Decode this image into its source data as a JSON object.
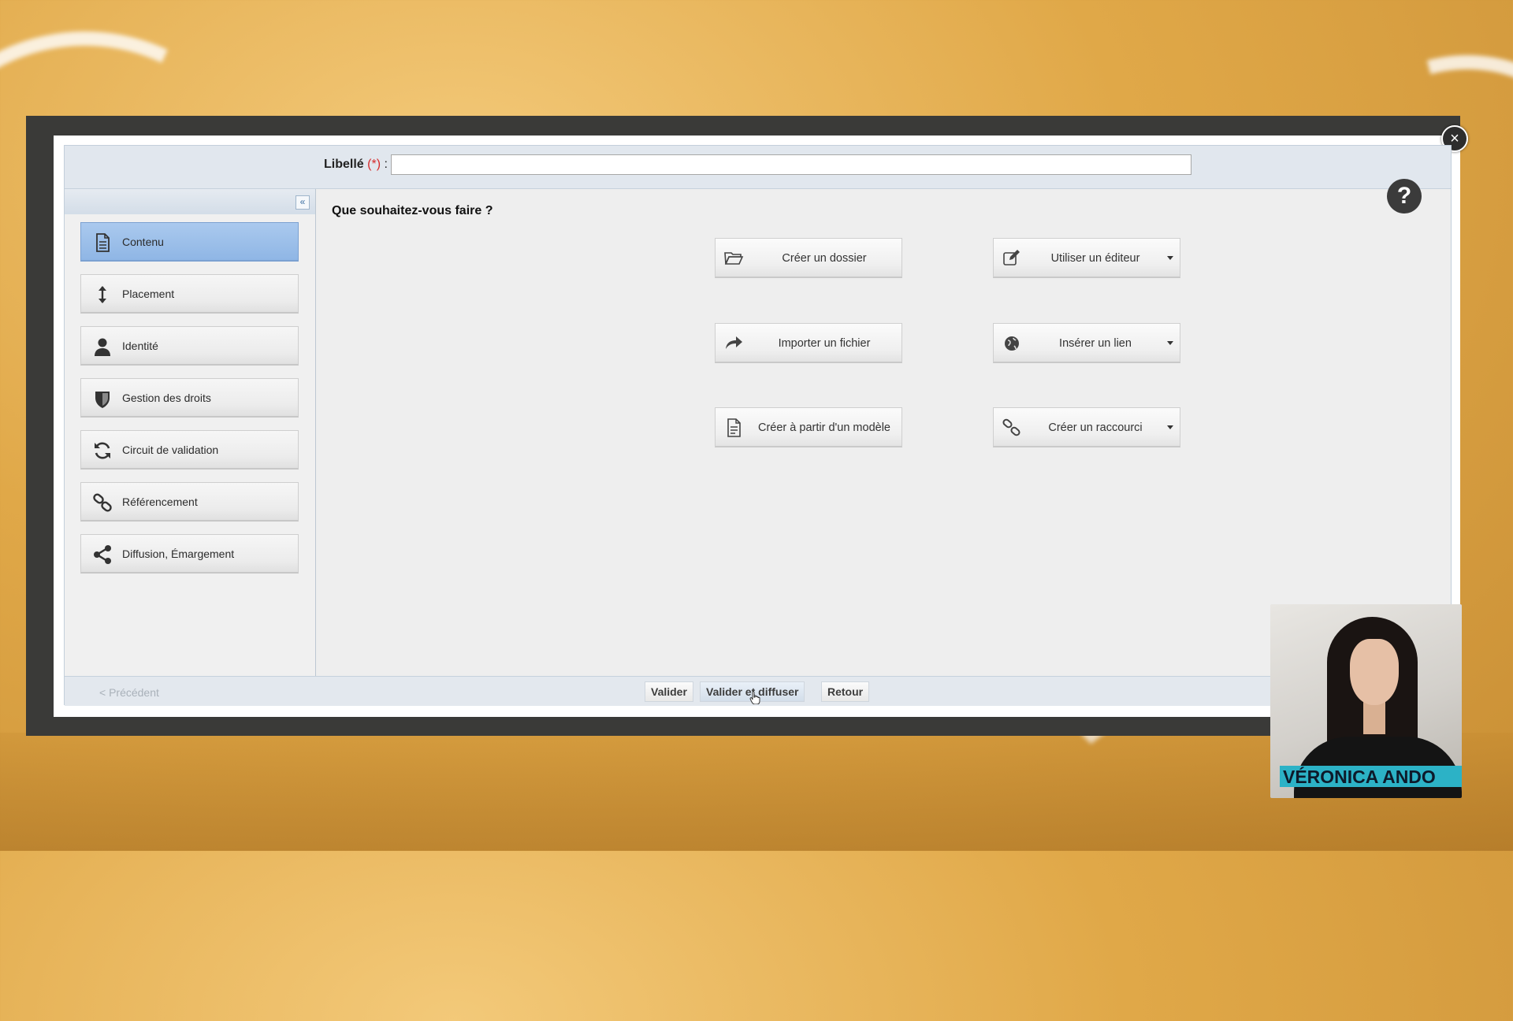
{
  "form": {
    "libelle_label": "Libellé",
    "required_marker": "(*)",
    "colon": ":",
    "libelle_value": ""
  },
  "dialog": {
    "close_symbol": "×",
    "help_symbol": "?",
    "collapse_symbol": "«"
  },
  "sidebar": {
    "items": [
      {
        "label": "Contenu",
        "icon": "document-icon",
        "active": true
      },
      {
        "label": "Placement",
        "icon": "vertical-arrows-icon",
        "active": false
      },
      {
        "label": "Identité",
        "icon": "user-icon",
        "active": false
      },
      {
        "label": "Gestion des droits",
        "icon": "shield-icon",
        "active": false
      },
      {
        "label": "Circuit de validation",
        "icon": "refresh-icon",
        "active": false
      },
      {
        "label": "Référencement",
        "icon": "link-icon",
        "active": false
      },
      {
        "label": "Diffusion, Émargement",
        "icon": "share-icon",
        "active": false
      }
    ]
  },
  "main": {
    "question": "Que souhaitez-vous faire ?",
    "actions": [
      {
        "label": "Créer un dossier",
        "icon": "folder-open-icon",
        "dropdown": false
      },
      {
        "label": "Utiliser un éditeur",
        "icon": "edit-icon",
        "dropdown": true
      },
      {
        "label": "Importer un fichier",
        "icon": "share-arrow-icon",
        "dropdown": false
      },
      {
        "label": "Insérer un lien",
        "icon": "globe-icon",
        "dropdown": true
      },
      {
        "label": "Créer à partir d'un modèle",
        "icon": "file-icon",
        "dropdown": false
      },
      {
        "label": "Créer un raccourci",
        "icon": "link-icon",
        "dropdown": true
      }
    ]
  },
  "footer": {
    "prev_label": "< Précédent",
    "validate_label": "Valider",
    "validate_publish_label": "Valider et diffuser",
    "back_label": "Retour"
  },
  "webcam": {
    "name": "VÉRONICA ANDO"
  },
  "colors": {
    "active_tab": "#9fc0ea",
    "required": "#d62b2b",
    "name_tag": "#2cb2c6"
  }
}
